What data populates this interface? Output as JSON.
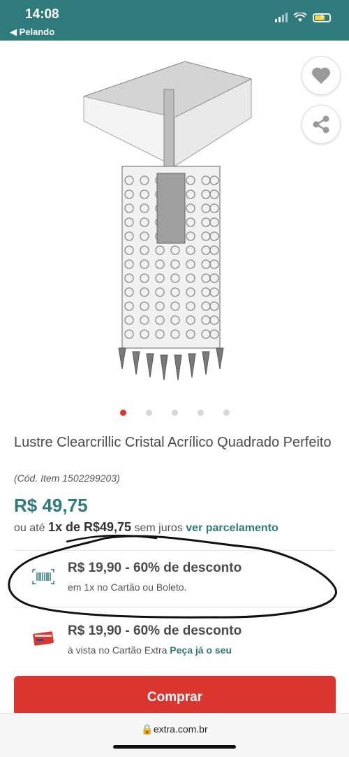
{
  "status_bar": {
    "time": "14:08",
    "back_label": "◀ Pelando"
  },
  "product": {
    "title": "Lustre Clearcrillic Cristal Acrílico Quadrado Perfeito",
    "code": "(Cód. Item 1502299203)",
    "price": "R$ 49,75",
    "installment_prefix": "ou até ",
    "installment_bold": "1x de R$49,75",
    "installment_mid": " sem juros ",
    "installment_link": "ver parcelamento",
    "carousel_active_index": 0,
    "carousel_count": 5
  },
  "offers": [
    {
      "main": "R$ 19,90 - 60% de desconto",
      "sub": "em 1x no Cartão ou Boleto.",
      "icon": "barcode-icon"
    },
    {
      "main": "R$ 19,90 - 60% de desconto",
      "sub_prefix": "à vista no Cartão Extra ",
      "sub_link": "Peça já o seu",
      "icon": "credit-card-icon"
    }
  ],
  "buy_button": {
    "label": "Comprar"
  },
  "browser": {
    "url": "extra.com.br"
  },
  "colors": {
    "teal": "#2f7a7a",
    "red": "#d9362f"
  }
}
